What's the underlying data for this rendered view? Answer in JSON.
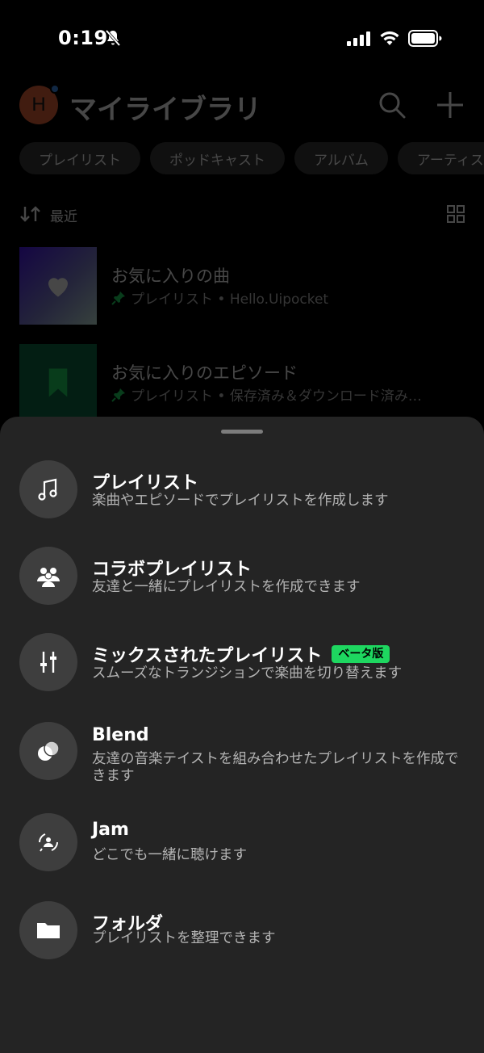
{
  "status_bar": {
    "time": "0:19"
  },
  "library": {
    "title": "マイライブラリ",
    "avatar_letter": "H",
    "chips": [
      "プレイリスト",
      "ポッドキャスト",
      "アルバム",
      "アーティスト"
    ],
    "sort_label": "最近",
    "items": [
      {
        "title": "お気に入りの曲",
        "subtitle": "プレイリスト • Hello.Uipocket"
      },
      {
        "title": "お気に入りのエピソード",
        "subtitle": "プレイリスト • 保存済み＆ダウンロード済み…"
      }
    ]
  },
  "sheet": {
    "options": [
      {
        "title": "プレイリスト",
        "desc": "楽曲やエピソードでプレイリストを作成します"
      },
      {
        "title": "コラボプレイリスト",
        "desc": "友達と一緒にプレイリストを作成できます"
      },
      {
        "title": "ミックスされたプレイリスト",
        "badge": "ベータ版",
        "desc": "スムーズなトランジションで楽曲を切り替えます"
      },
      {
        "title": "Blend",
        "desc": "友達の音楽テイストを組み合わせたプレイリストを作成できます"
      },
      {
        "title": "Jam",
        "desc": "どこでも一緒に聴けます"
      },
      {
        "title": "フォルダ",
        "desc": "プレイリストを整理できます"
      }
    ]
  },
  "colors": {
    "accent": "#1ed760",
    "sheet_bg": "#242424",
    "icon_circle": "#3e3e3e",
    "avatar": "#e8643a"
  }
}
